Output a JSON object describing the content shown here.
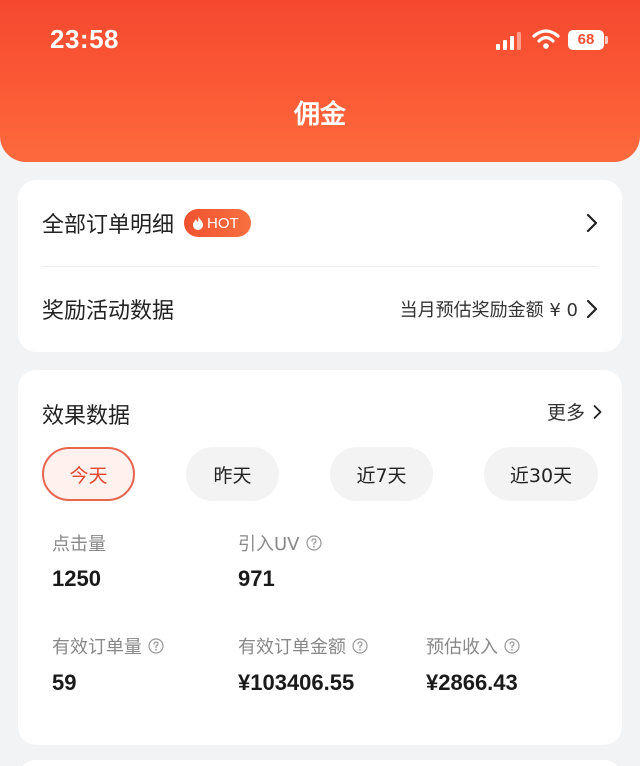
{
  "status_bar": {
    "time": "23:58",
    "battery": "68"
  },
  "header": {
    "title": "佣金"
  },
  "links": {
    "orders": {
      "label": "全部订单明细",
      "badge": "HOT"
    },
    "rewards": {
      "label": "奖励活动数据",
      "value": "当月预估奖励金额 ¥ 0"
    }
  },
  "effect": {
    "title": "效果数据",
    "more": "更多",
    "tabs": [
      {
        "label": "今天",
        "active": true
      },
      {
        "label": "昨天",
        "active": false
      },
      {
        "label": "近7天",
        "active": false
      },
      {
        "label": "近30天",
        "active": false
      }
    ],
    "metrics": {
      "clicks": {
        "label": "点击量",
        "value": "1250"
      },
      "uv": {
        "label": "引入UV",
        "value": "971"
      },
      "valid_orders": {
        "label": "有效订单量",
        "value": "59"
      },
      "order_amount": {
        "label": "有效订单金额",
        "value": "¥103406.55"
      },
      "est_income": {
        "label": "预估收入",
        "value": "¥2866.43"
      }
    }
  },
  "colors": {
    "brand": "#f5482f",
    "active_chip_border": "#e8664f",
    "page_bg": "#f2f3f5"
  }
}
